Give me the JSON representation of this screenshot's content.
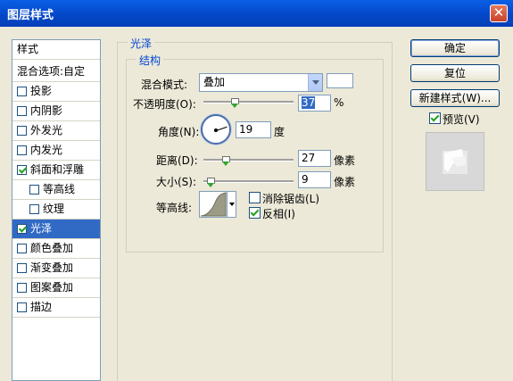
{
  "window": {
    "title": "图层样式",
    "close_glyph": "✕"
  },
  "styles_list": {
    "header": "样式",
    "blend_options": "混合选项:自定",
    "items": [
      {
        "label": "投影",
        "checked": false
      },
      {
        "label": "内阴影",
        "checked": false
      },
      {
        "label": "外发光",
        "checked": false
      },
      {
        "label": "内发光",
        "checked": false
      },
      {
        "label": "斜面和浮雕",
        "checked": true
      },
      {
        "label": "等高线",
        "checked": false
      },
      {
        "label": "纹理",
        "checked": false
      },
      {
        "label": "光泽",
        "checked": true
      },
      {
        "label": "颜色叠加",
        "checked": false
      },
      {
        "label": "渐变叠加",
        "checked": false
      },
      {
        "label": "图案叠加",
        "checked": false
      },
      {
        "label": "描边",
        "checked": false
      }
    ],
    "selected": "光泽"
  },
  "satin": {
    "group_title": "光泽",
    "structure_title": "结构",
    "blend_mode_label": "混合模式:",
    "blend_mode_value": "叠加",
    "swatch_color": "#ffffff",
    "opacity_label": "不透明度(O):",
    "opacity_value": "37",
    "opacity_unit": "%",
    "angle_label": "角度(N):",
    "angle_value": "19",
    "angle_unit": "度",
    "distance_label": "距离(D):",
    "distance_value": "27",
    "distance_unit": "像素",
    "size_label": "大小(S):",
    "size_value": "9",
    "size_unit": "像素",
    "contour_label": "等高线:",
    "anti_alias_label": "消除锯齿(L)",
    "anti_alias_checked": false,
    "invert_label": "反相(I)",
    "invert_checked": true
  },
  "buttons": {
    "ok": "确定",
    "reset": "复位",
    "new_style": "新建样式(W)...",
    "preview_label": "预览(V)",
    "preview_checked": true
  },
  "colors": {
    "titlebar": "#0a5fe6",
    "selection": "#316ac5",
    "group_title": "#0046d5"
  }
}
